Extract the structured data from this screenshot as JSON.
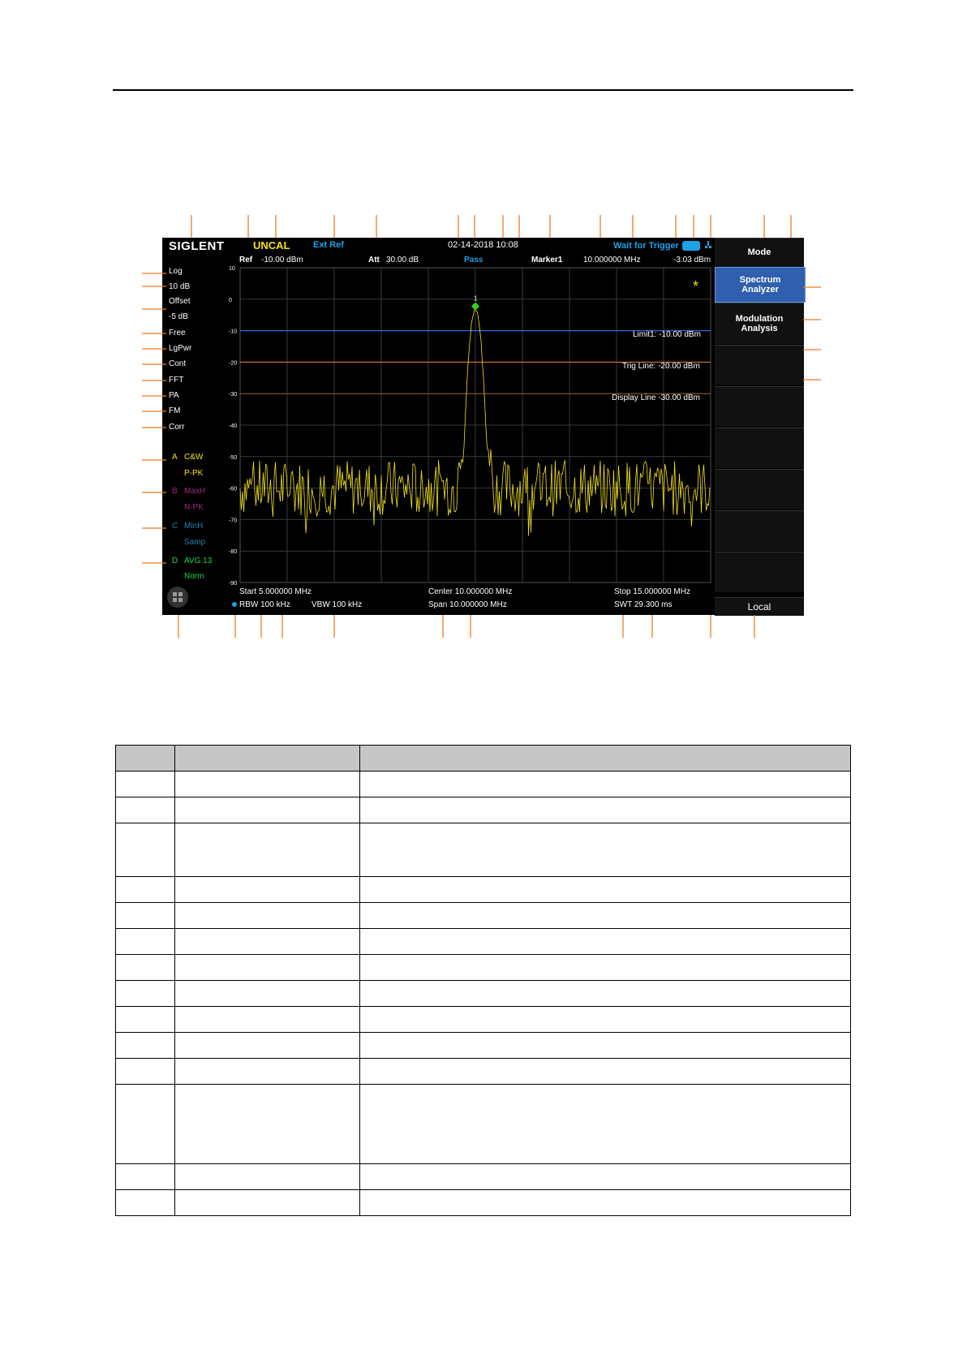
{
  "header": {
    "brand": "SIGLENT",
    "uncal": "UNCAL",
    "ext_ref": "Ext Ref",
    "datetime": "02-14-2018 10:08",
    "trigger_status": "Wait for Trigger"
  },
  "row2": {
    "ref_label": "Ref",
    "ref_value": "-10.00 dBm",
    "att_label": "Att",
    "att_value": "30.00 dB",
    "pass": "Pass",
    "marker_label": "Marker1",
    "marker_freq": "10.000000 MHz",
    "marker_amp": "-3.03 dBm"
  },
  "left_panel": {
    "items": [
      "Log",
      "10 dB",
      "Offset",
      "-5 dB",
      "Free",
      "LgPwr",
      "Cont",
      "FFT",
      "PA",
      "FM",
      "Corr"
    ],
    "traces": [
      {
        "letter": "A",
        "mode": "C&W",
        "detector": "P-PK",
        "color": "#f3e21a"
      },
      {
        "letter": "B",
        "mode": "MaxH",
        "detector": "N-PK",
        "color": "#a0287a"
      },
      {
        "letter": "C",
        "mode": "MinH",
        "detector": "Samp",
        "color": "#1c86a8"
      },
      {
        "letter": "D",
        "mode": "AVG 13",
        "detector": "Norm",
        "color": "#1ed64a"
      }
    ]
  },
  "plot": {
    "y_ticks": [
      "10",
      "0",
      "-10",
      "-20",
      "-30",
      "-40",
      "-50",
      "-60",
      "-70",
      "-80",
      "-90"
    ],
    "marker_number": "1",
    "limit_line": "Limit1: -10.00 dBm",
    "trig_line": "Trig Line: -20.00 dBm",
    "display_line": "Display Line -30.00 dBm",
    "star": "*"
  },
  "footer": {
    "start": "Start  5.000000 MHz",
    "center": "Center  10.000000 MHz",
    "stop": "Stop  15.000000 MHz",
    "rbw": "RBW  100 kHz",
    "vbw": "VBW  100 kHz",
    "span": "Span   10.000000 MHz",
    "swt": "SWT  29.300 ms"
  },
  "softkeys": {
    "mode": "Mode",
    "spectrum_analyzer": "Spectrum Analyzer",
    "modulation_analysis": "Modulation Analysis",
    "local": "Local"
  },
  "colors": {
    "trace": "#f3e21a",
    "limit": "#2f6ad6",
    "trig": "#f07b22",
    "display": "#8e5a2f",
    "accent_blue": "#1aa3e8",
    "callout": "#f07b22"
  }
}
